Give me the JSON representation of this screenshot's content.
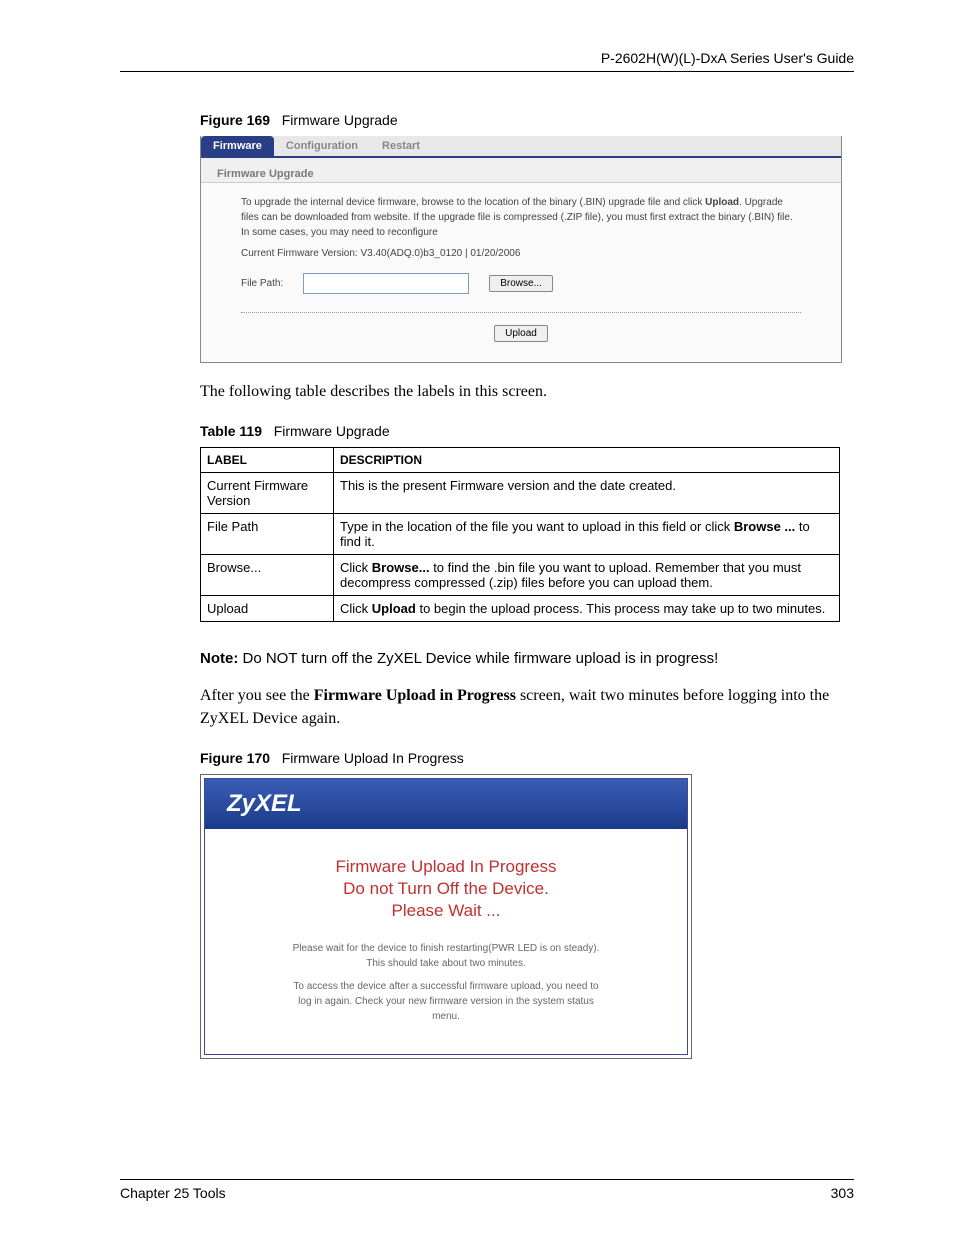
{
  "header": {
    "guide_title": "P-2602H(W)(L)-DxA Series User's Guide"
  },
  "figure169": {
    "caption_num": "Figure 169",
    "caption_text": "Firmware Upgrade",
    "tabs": {
      "firmware": "Firmware",
      "configuration": "Configuration",
      "restart": "Restart"
    },
    "section_title": "Firmware Upgrade",
    "para_pre": "To upgrade the internal device firmware, browse to the location of the binary (.BIN) upgrade file and click ",
    "para_bold": "Upload",
    "para_post": ". Upgrade files can be downloaded from website. If the upgrade file is compressed (.ZIP file), you must first extract the binary (.BIN) file. In some cases, you may need to reconfigure",
    "version_line": "Current Firmware Version: V3.40(ADQ.0)b3_0120 | 01/20/2006",
    "file_label": "File Path:",
    "browse_btn": "Browse...",
    "upload_btn": "Upload"
  },
  "intro_text": "The following table describes the labels in this screen.",
  "table119": {
    "caption_num": "Table 119",
    "caption_text": "Firmware Upgrade",
    "head_label": "LABEL",
    "head_desc": "DESCRIPTION",
    "rows": [
      {
        "label": "Current Firmware Version",
        "desc_pre": "This is the present Firmware version and the date created.",
        "desc_bold": "",
        "desc_post": ""
      },
      {
        "label": "File Path",
        "desc_pre": "Type in the location of the file you want to upload in this field or click ",
        "desc_bold": "Browse ...",
        "desc_post": " to find it."
      },
      {
        "label": "Browse...",
        "desc_pre": "Click ",
        "desc_bold": "Browse...",
        "desc_post": " to find the .bin file you want to upload. Remember that you must decompress compressed (.zip) files before you can upload them."
      },
      {
        "label": "Upload",
        "desc_pre": "Click ",
        "desc_bold": "Upload",
        "desc_post": " to begin the upload process. This process may take up to two minutes."
      }
    ]
  },
  "note": {
    "label": "Note:",
    "text": " Do NOT turn off the ZyXEL Device while firmware upload is in progress!"
  },
  "after_note": {
    "pre": "After you see the ",
    "bold": "Firmware Upload in Progress",
    "post": " screen, wait two minutes before logging into the ZyXEL Device again."
  },
  "figure170": {
    "caption_num": "Figure 170",
    "caption_text": "Firmware Upload In Progress",
    "logo": "ZyXEL",
    "line1": "Firmware Upload In Progress",
    "line2": "Do not Turn Off the Device.",
    "line3": "Please Wait ...",
    "msg1": "Please wait for the device to finish restarting(PWR LED is on steady). This should take about two minutes.",
    "msg2": "To access the device after a successful firmware upload, you need to log in again. Check your new firmware version in the system status menu."
  },
  "footer": {
    "left": "Chapter 25 Tools",
    "right": "303"
  }
}
